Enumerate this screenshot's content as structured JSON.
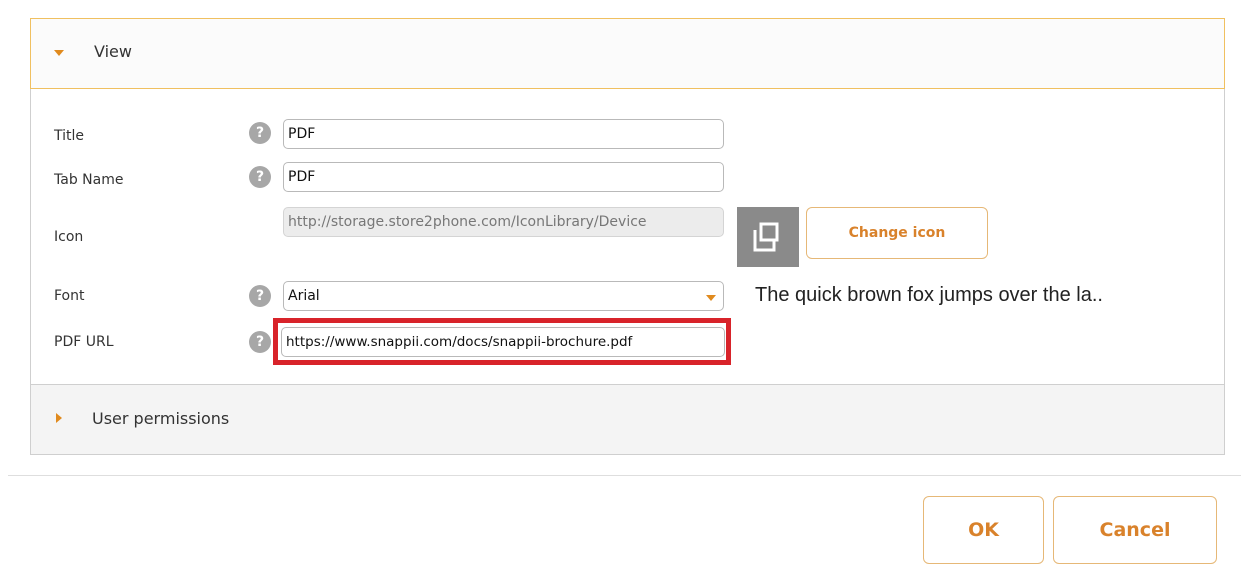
{
  "sections": {
    "view": {
      "title": "View",
      "expanded": true
    },
    "user_permissions": {
      "title": "User permissions",
      "expanded": false
    }
  },
  "fields": {
    "title": {
      "label": "Title",
      "value": "PDF"
    },
    "tab_name": {
      "label": "Tab Name",
      "value": "PDF"
    },
    "icon": {
      "label": "Icon",
      "value": "http://storage.store2phone.com/IconLibrary/Device",
      "change_button": "Change icon"
    },
    "font": {
      "label": "Font",
      "value": "Arial",
      "preview_text": "The quick brown fox jumps over the la.."
    },
    "pdf_url": {
      "label": "PDF URL",
      "value": "https://www.snappii.com/docs/snappii-brochure.pdf"
    }
  },
  "help_glyph": "?",
  "buttons": {
    "ok": "OK",
    "cancel": "Cancel"
  },
  "colors": {
    "accent": "#d9822b",
    "caret": "#e08a1e",
    "highlight": "#d8232a",
    "help_icon": "#a7a7a7"
  },
  "icons": {
    "view_caret": "caret-down-icon",
    "permissions_caret": "caret-right-icon",
    "help": "help-icon",
    "icon_preview": "tab-icon",
    "select_arrow": "chevron-down-icon"
  }
}
